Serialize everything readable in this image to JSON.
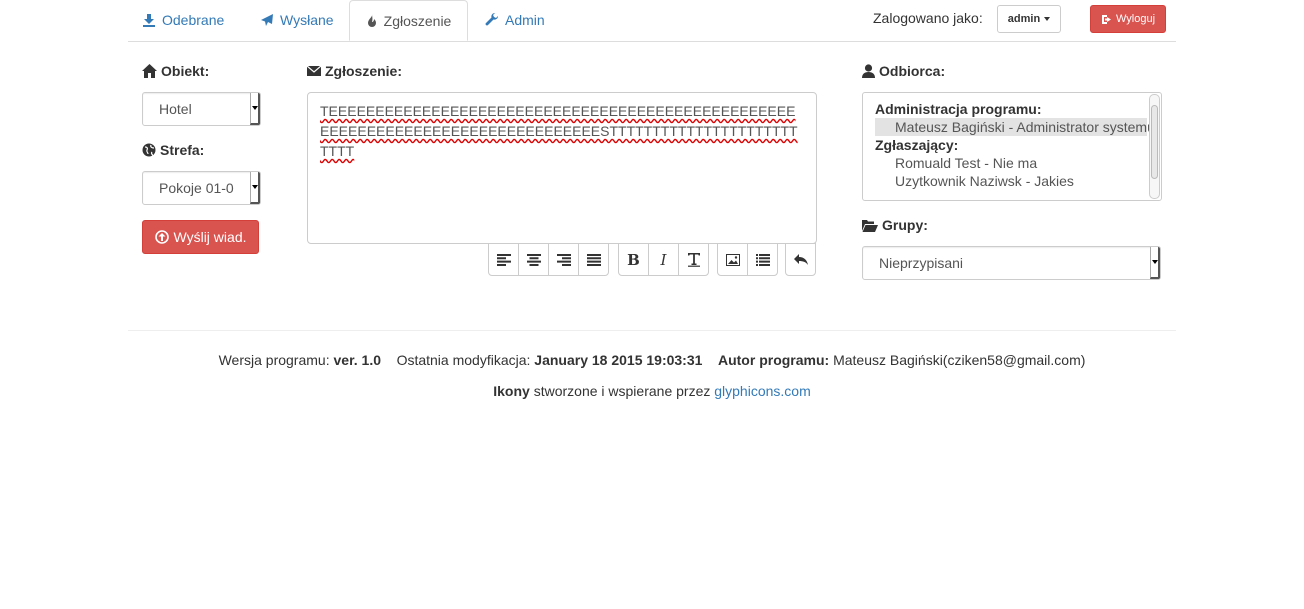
{
  "nav": {
    "tabs": [
      {
        "label": "Odebrane",
        "icon": "download-icon"
      },
      {
        "label": "Wysłane",
        "icon": "send-icon"
      },
      {
        "label": "Zgłoszenie",
        "icon": "fire-icon",
        "active": true
      },
      {
        "label": "Admin",
        "icon": "wrench-icon"
      }
    ],
    "logged_as_label": "Zalogowano jako:",
    "user_button": "admin",
    "logout_button": "Wyloguj"
  },
  "left": {
    "object_label": "Obiekt:",
    "object_value": "Hotel",
    "zone_label": "Strefa:",
    "zone_value": "Pokoje 01-0",
    "send_button": "Wyślij wiad."
  },
  "editor": {
    "label": "Zgłoszenie:",
    "content": "TEEEEEEEEEEEEEEEEEEEEEEEEEEEEEEEEEEEEEEEEEEEEEEEEEEEEEEEEEEEEEEEEEEEEEEEEEEEEEEEESTTTTTTTTTTTTTTTTTTTTTTTTTT"
  },
  "recipient": {
    "label": "Odbiorca:",
    "groups": [
      {
        "name": "Administracja programu:",
        "options": [
          {
            "text": "Mateusz Bagiński - Administrator systemu",
            "selected": true
          }
        ]
      },
      {
        "name": "Zgłaszający:",
        "options": [
          {
            "text": "Romuald Test - Nie ma",
            "selected": false
          },
          {
            "text": "Uzytkownik Naziwsk - Jakies",
            "selected": false
          }
        ]
      }
    ],
    "groups_label": "Grupy:",
    "groups_value": "Nieprzypisani"
  },
  "footer": {
    "version_label": "Wersja programu:",
    "version_value": "ver. 1.0",
    "modified_label": "Ostatnia modyfikacja:",
    "modified_value": "January 18 2015 19:03:31",
    "author_label": "Autor programu:",
    "author_value": "Mateusz Bagiński(cziken58@gmail.com)",
    "icons_bold": "Ikony",
    "icons_text": "stworzone i wspierane przez",
    "icons_link": "glyphicons.com"
  },
  "colors": {
    "link": "#337ab7",
    "danger": "#d9534f"
  }
}
